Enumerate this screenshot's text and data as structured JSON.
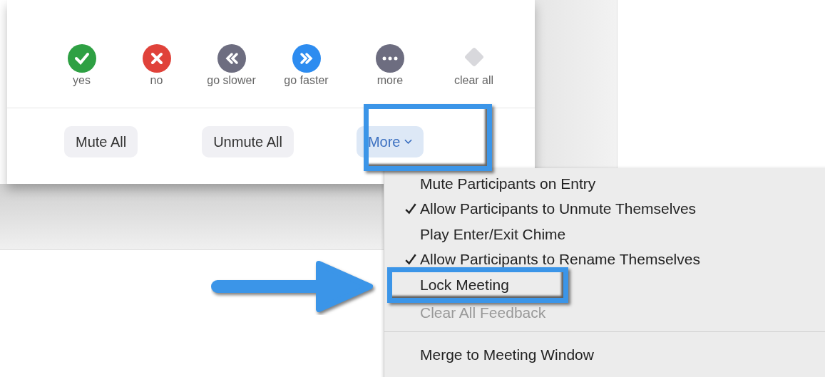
{
  "feedback": [
    {
      "kind": "yes",
      "label": "yes"
    },
    {
      "kind": "no",
      "label": "no"
    },
    {
      "kind": "slower",
      "label": "go slower"
    },
    {
      "kind": "faster",
      "label": "go faster"
    },
    {
      "kind": "more",
      "label": "more"
    },
    {
      "kind": "clear",
      "label": "clear all"
    }
  ],
  "buttons": [
    {
      "label": "Mute All",
      "kind": "plain"
    },
    {
      "label": "Unmute All",
      "kind": "plain"
    },
    {
      "label": "More",
      "kind": "dropdown",
      "expanded": true
    }
  ],
  "menu": [
    {
      "kind": "item",
      "label": "Mute Participants on Entry",
      "checked": false,
      "disabled": false
    },
    {
      "kind": "item",
      "label": "Allow Participants to Unmute Themselves",
      "checked": true,
      "disabled": false
    },
    {
      "kind": "item",
      "label": "Play Enter/Exit Chime",
      "checked": false,
      "disabled": false
    },
    {
      "kind": "item",
      "label": "Allow Participants to Rename Themselves",
      "checked": true,
      "disabled": false
    },
    {
      "kind": "item",
      "label": "Lock Meeting",
      "checked": false,
      "disabled": false
    },
    {
      "kind": "item",
      "label": "Clear All Feedback",
      "checked": false,
      "disabled": true
    },
    {
      "kind": "separator"
    },
    {
      "kind": "item",
      "label": "Merge to Meeting Window",
      "checked": false,
      "disabled": false
    }
  ]
}
